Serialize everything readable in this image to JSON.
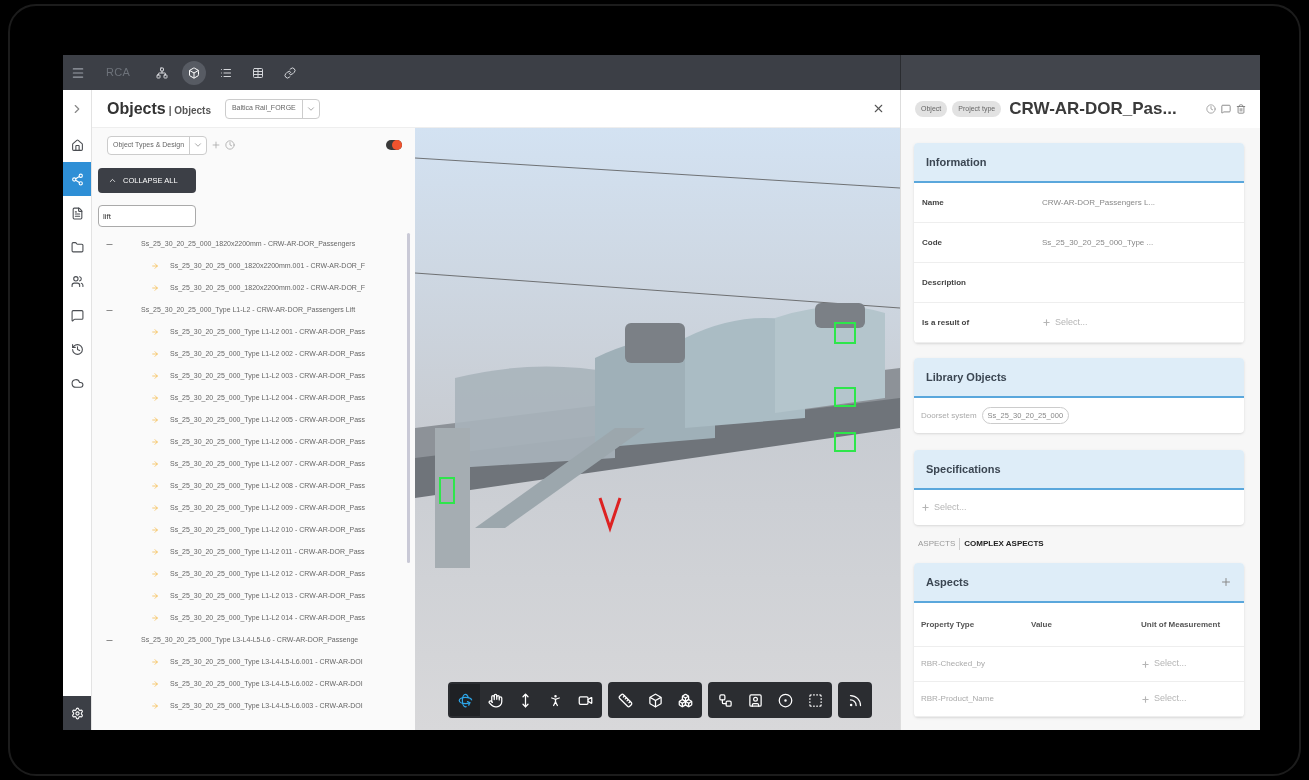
{
  "top_bar": {
    "logo": "RCA",
    "tools": [
      {
        "kind": "tree",
        "selected": false
      },
      {
        "kind": "cube",
        "selected": true
      },
      {
        "kind": "list",
        "selected": false
      },
      {
        "kind": "table",
        "selected": false
      },
      {
        "kind": "link",
        "selected": false
      }
    ]
  },
  "rail": {
    "items": [
      {
        "kind": "home",
        "selected": false
      },
      {
        "kind": "objects",
        "selected": true
      },
      {
        "kind": "document",
        "selected": false
      },
      {
        "kind": "folder",
        "selected": false
      },
      {
        "kind": "users",
        "selected": false
      },
      {
        "kind": "comment",
        "selected": false
      },
      {
        "kind": "history",
        "selected": false
      },
      {
        "kind": "cloud",
        "selected": false
      }
    ]
  },
  "header": {
    "title": "Objects",
    "subtitle": "| Objects",
    "project": "Baltica Rail_FORGE"
  },
  "filter": {
    "view": "Object Types & Design",
    "toggle_on": true
  },
  "collapse_button": "COLLAPSE ALL",
  "search": {
    "value": "lift"
  },
  "tree": [
    {
      "label": "Ss_25_30_20_25_000_1820x2200mm - CRW-AR-DOR_Passengers",
      "expanded": true,
      "children": [
        {
          "label": "Ss_25_30_20_25_000_1820x2200mm.001 - CRW-AR-DOR_F"
        },
        {
          "label": "Ss_25_30_20_25_000_1820x2200mm.002 - CRW-AR-DOR_F"
        }
      ]
    },
    {
      "label": "Ss_25_30_20_25_000_Type L1-L2 - CRW-AR-DOR_Passengers Lift",
      "expanded": true,
      "children": [
        {
          "label": "Ss_25_30_20_25_000_Type L1-L2 001 - CRW-AR-DOR_Pass"
        },
        {
          "label": "Ss_25_30_20_25_000_Type L1-L2 002 - CRW-AR-DOR_Pass"
        },
        {
          "label": "Ss_25_30_20_25_000_Type L1-L2 003 - CRW-AR-DOR_Pass"
        },
        {
          "label": "Ss_25_30_20_25_000_Type L1-L2 004 - CRW-AR-DOR_Pass"
        },
        {
          "label": "Ss_25_30_20_25_000_Type L1-L2 005 - CRW-AR-DOR_Pass"
        },
        {
          "label": "Ss_25_30_20_25_000_Type L1-L2 006 - CRW-AR-DOR_Pass"
        },
        {
          "label": "Ss_25_30_20_25_000_Type L1-L2 007 - CRW-AR-DOR_Pass"
        },
        {
          "label": "Ss_25_30_20_25_000_Type L1-L2 008 - CRW-AR-DOR_Pass"
        },
        {
          "label": "Ss_25_30_20_25_000_Type L1-L2 009 - CRW-AR-DOR_Pass"
        },
        {
          "label": "Ss_25_30_20_25_000_Type L1-L2 010 - CRW-AR-DOR_Pass"
        },
        {
          "label": "Ss_25_30_20_25_000_Type L1-L2 011 - CRW-AR-DOR_Pass"
        },
        {
          "label": "Ss_25_30_20_25_000_Type L1-L2 012 - CRW-AR-DOR_Pass"
        },
        {
          "label": "Ss_25_30_20_25_000_Type L1-L2 013 - CRW-AR-DOR_Pass"
        },
        {
          "label": "Ss_25_30_20_25_000_Type L1-L2 014 - CRW-AR-DOR_Pass"
        }
      ]
    },
    {
      "label": "Ss_25_30_20_25_000_Type L3-L4-L5-L6 - CRW-AR-DOR_Passenge",
      "expanded": true,
      "children": [
        {
          "label": "Ss_25_30_20_25_000_Type L3-L4-L5-L6.001 - CRW-AR-DOI"
        },
        {
          "label": "Ss_25_30_20_25_000_Type L3-L4-L5-L6.002 - CRW-AR-DOI"
        },
        {
          "label": "Ss_25_30_20_25_000_Type L3-L4-L5-L6.003 - CRW-AR-DOI"
        }
      ]
    }
  ],
  "toolbar": {
    "groups": [
      [
        {
          "kind": "orbit",
          "selected": true
        },
        {
          "kind": "pan",
          "selected": false
        },
        {
          "kind": "zoom",
          "selected": false
        },
        {
          "kind": "walk",
          "selected": false
        },
        {
          "kind": "camera",
          "selected": false
        }
      ],
      [
        {
          "kind": "measure",
          "selected": false
        },
        {
          "kind": "section",
          "selected": false
        },
        {
          "kind": "explode",
          "selected": false
        }
      ],
      [
        {
          "kind": "structure",
          "selected": false
        },
        {
          "kind": "properties",
          "selected": false
        },
        {
          "kind": "settings",
          "selected": false
        },
        {
          "kind": "fullscreen",
          "selected": false
        }
      ],
      [
        {
          "kind": "feed",
          "selected": false
        }
      ]
    ]
  },
  "details": {
    "badges": [
      "Object",
      "Project type"
    ],
    "title": "CRW-AR-DOR_Pas...",
    "information": {
      "title": "Information",
      "rows": [
        {
          "label": "Name",
          "value": "CRW-AR-DOR_Passengers L..."
        },
        {
          "label": "Code",
          "value": "Ss_25_30_20_25_000_Type ..."
        },
        {
          "label": "Description"
        },
        {
          "label": "Is a result of",
          "select": "Select..."
        }
      ]
    },
    "library": {
      "title": "Library Objects",
      "label": "Doorset system",
      "chip": "Ss_25_30_20_25_000"
    },
    "specifications": {
      "title": "Specifications",
      "select": "Select..."
    },
    "aspect_tabs": [
      {
        "label": "ASPECTS",
        "selected": false
      },
      {
        "label": "COMPLEX ASPECTS",
        "selected": true
      }
    ],
    "aspects": {
      "title": "Aspects",
      "columns": [
        "Property Type",
        "Value",
        "Unit of Measurement"
      ],
      "rows": [
        {
          "property": "RBR-Checked_by",
          "unit": "Select..."
        },
        {
          "property": "RBR-Product_Name",
          "unit": "Select..."
        }
      ]
    }
  }
}
